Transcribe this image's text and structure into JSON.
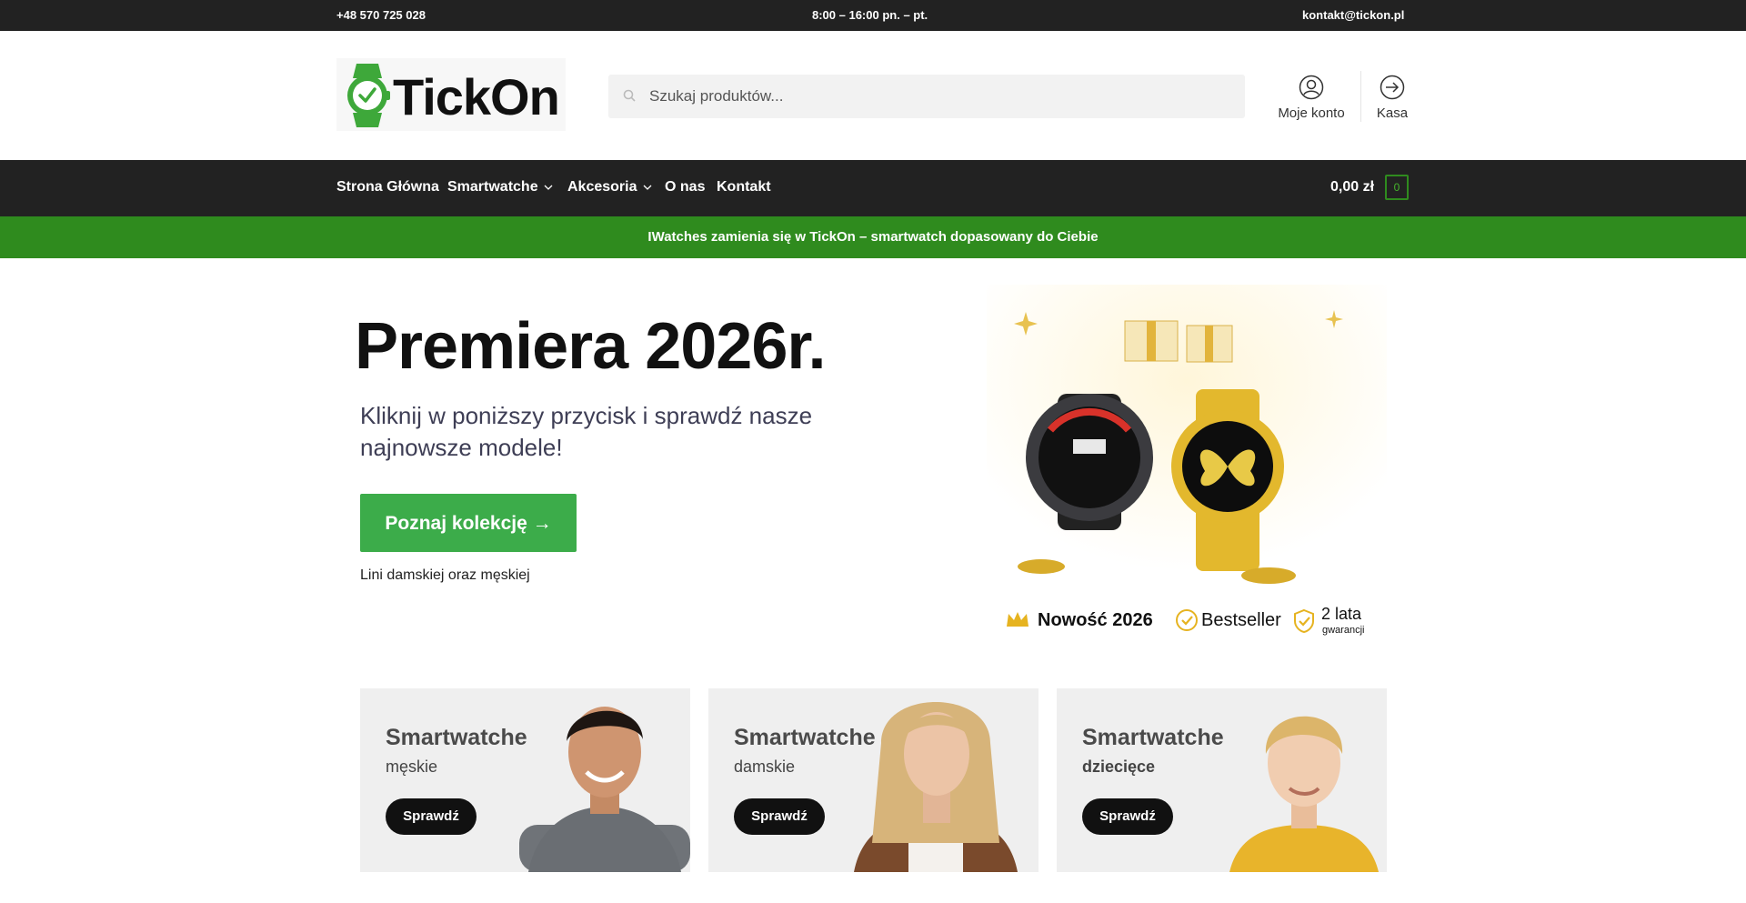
{
  "topbar": {
    "phone": "+48 570 725 028",
    "hours": "8:00 – 16:00 pn. – pt.",
    "email": "kontakt@tickon.pl"
  },
  "header": {
    "logo_text": "TickOn",
    "search_placeholder": "Szukaj produktów...",
    "account_label": "Moje konto",
    "checkout_label": "Kasa"
  },
  "nav": {
    "items": [
      "Strona Główna",
      "Smartwatche",
      "Akcesoria",
      "O nas",
      "Kontakt"
    ],
    "cart_total": "0,00 zł",
    "cart_count": "0"
  },
  "promo_text": "IWatches zamienia się w TickOn – smartwatch dopasowany do Ciebie",
  "hero": {
    "title": "Premiera 2026r.",
    "subtitle": "Kliknij w poniższy przycisk i sprawdź nasze najnowsze modele!",
    "cta_label": "Poznaj kolekcję →",
    "cta_note": "Lini damskiej oraz męskiej",
    "badges": [
      "Nowość 2026",
      "Bestseller",
      "2 lata",
      "gwarancji"
    ]
  },
  "categories": [
    {
      "title": "Smartwatche",
      "subtitle": "męskie",
      "button": "Sprawdź"
    },
    {
      "title": "Smartwatche",
      "subtitle": "damskie",
      "button": "Sprawdź"
    },
    {
      "title": "Smartwatche",
      "subtitle": "dziecięce",
      "button": "Sprawdź"
    }
  ],
  "colors": {
    "dark_bar": "#222222",
    "brand_green": "#2f8b1e",
    "cta_green": "#3cac4a"
  }
}
